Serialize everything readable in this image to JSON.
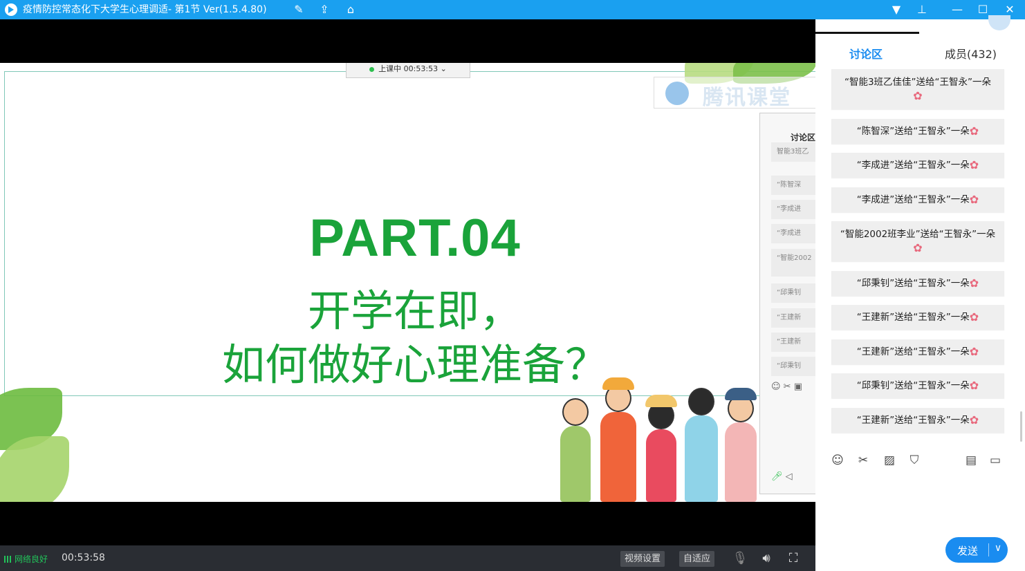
{
  "titlebar": {
    "title": "疫情防控常态化下大学生心理调适- 第1节 Ver(1.5.4.80)"
  },
  "slide": {
    "status_label": "上课中 00:53:53",
    "part": "PART.04",
    "line1": "开学在即，",
    "line2": "如何做好心理准备？",
    "watermark": "腾讯课堂",
    "mini_panel_title": "讨论区",
    "mini_items": [
      "智能3班乙",
      "“陈智深",
      "“李成进",
      "“李成进",
      "“智能2002",
      "“邱秉钊",
      "“王建新",
      "“王建新",
      "“邱秉钊"
    ]
  },
  "bottombar": {
    "network": "网络良好",
    "elapsed": "00:53:58",
    "video_settings": "视频设置",
    "adaptive": "自适应"
  },
  "panel": {
    "tab_discuss": "讨论区",
    "tab_members": "成员(432)",
    "messages": [
      "“智能3班乙佳佳”送给“王智永”一朵",
      "“陈智深”送给“王智永”一朵",
      "“李成进”送给“王智永”一朵",
      "“李成进”送给“王智永”一朵",
      "“智能2002班李业”送给“王智永”一朵",
      "“邱秉钊”送给“王智永”一朵",
      "“王建新”送给“王智永”一朵",
      "“王建新”送给“王智永”一朵",
      "“邱秉钊”送给“王智永”一朵",
      "“王建新”送给“王智永”一朵"
    ],
    "send_label": "发送"
  },
  "colors": {
    "titlebar": "#1aa0f0",
    "slide_text": "#1aa33a",
    "accent": "#1a8cf0",
    "flower": "#e8697d"
  }
}
